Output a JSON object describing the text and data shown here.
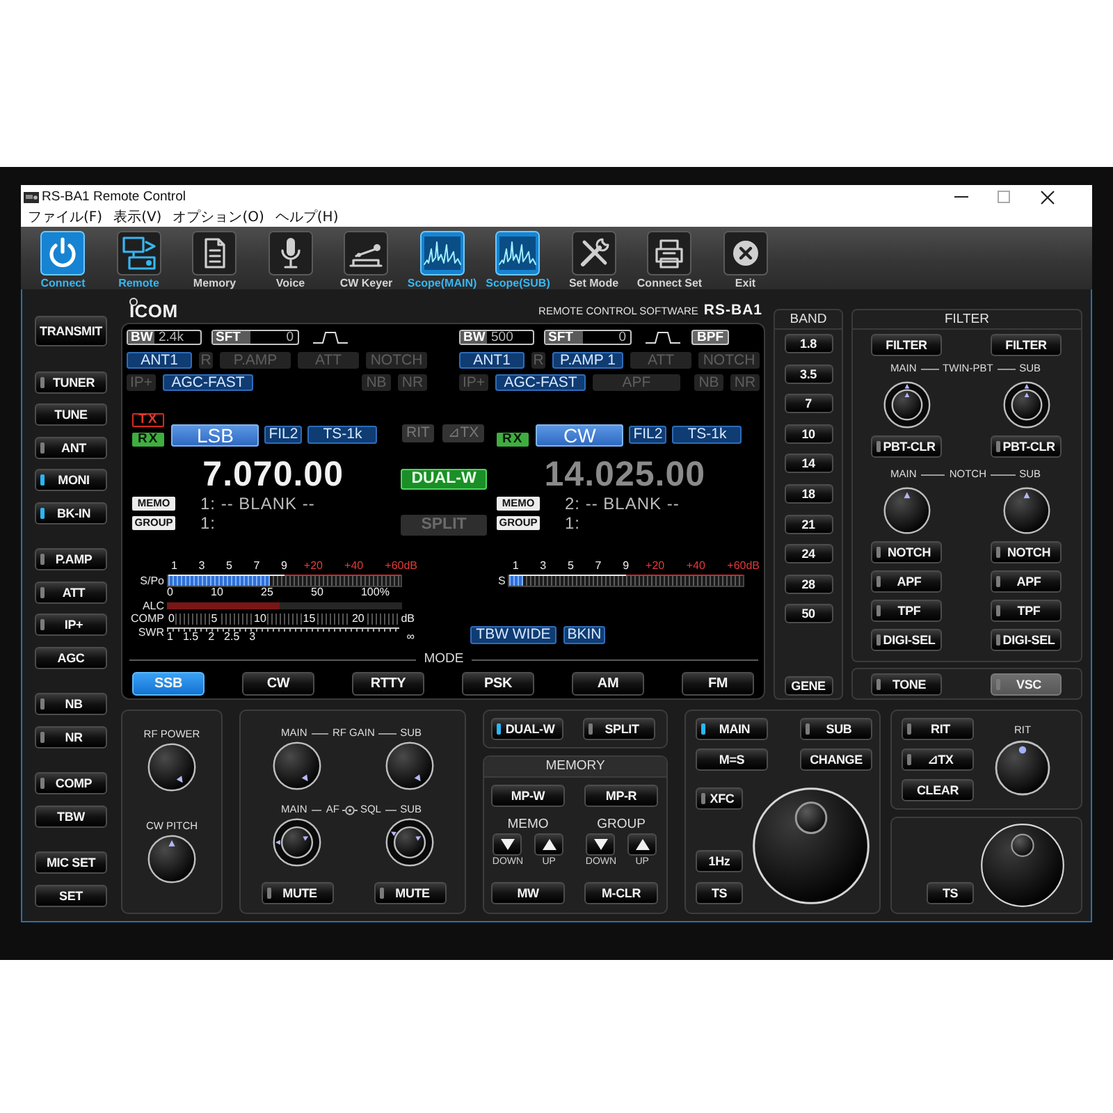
{
  "window": {
    "title": "RS-BA1 Remote Control"
  },
  "menu": [
    "ファイル(F)",
    "表示(V)",
    "オプション(O)",
    "ヘルプ(H)"
  ],
  "toolbar": [
    {
      "label": "Connect",
      "kind": "power",
      "selected": true
    },
    {
      "label": "Remote",
      "kind": "remote",
      "selected": true
    },
    {
      "label": "Memory",
      "kind": "memory",
      "selected": false
    },
    {
      "label": "Voice",
      "kind": "mic",
      "selected": false
    },
    {
      "label": "CW Keyer",
      "kind": "key",
      "selected": false
    },
    {
      "label": "Scope(MAIN)",
      "kind": "scope",
      "selected": true
    },
    {
      "label": "Scope(SUB)",
      "kind": "scope",
      "selected": true
    },
    {
      "label": "Set Mode",
      "kind": "tools",
      "selected": false
    },
    {
      "label": "Connect Set",
      "kind": "printer",
      "selected": false
    },
    {
      "label": "Exit",
      "kind": "exit",
      "selected": false
    }
  ],
  "left_panel": [
    {
      "buttons": [
        {
          "label": "TRANSMIT",
          "kind": "large"
        }
      ]
    },
    {
      "buttons": [
        {
          "label": "TUNER",
          "kind": "led",
          "on": false
        },
        {
          "label": "TUNE",
          "kind": "plain"
        },
        {
          "label": "ANT",
          "kind": "led",
          "on": false
        },
        {
          "label": "MONI",
          "kind": "led",
          "on": true
        },
        {
          "label": "BK-IN",
          "kind": "led",
          "on": true
        }
      ]
    },
    {
      "buttons": [
        {
          "label": "P.AMP",
          "kind": "led",
          "on": false
        },
        {
          "label": "ATT",
          "kind": "led",
          "on": false
        },
        {
          "label": "IP+",
          "kind": "led",
          "on": false
        },
        {
          "label": "AGC",
          "kind": "plain"
        }
      ]
    },
    {
      "buttons": [
        {
          "label": "NB",
          "kind": "led",
          "on": false
        },
        {
          "label": "NR",
          "kind": "led",
          "on": false
        }
      ]
    },
    {
      "buttons": [
        {
          "label": "COMP",
          "kind": "led",
          "on": false
        },
        {
          "label": "TBW",
          "kind": "plain"
        }
      ]
    },
    {
      "buttons": [
        {
          "label": "MIC SET",
          "kind": "plain"
        },
        {
          "label": "SET",
          "kind": "plain"
        }
      ]
    }
  ],
  "display": {
    "brand": "ICOM",
    "software": "REMOTE CONTROL SOFTWARE",
    "model": "RS-BA1",
    "receivers": [
      {
        "selected": true,
        "bw": {
          "label": "BW",
          "value": "2.4k"
        },
        "sft": {
          "label": "SFT",
          "value": "0"
        },
        "row2": [
          {
            "label": "ANT1",
            "on": true
          },
          {
            "label": "R",
            "on": false
          },
          {
            "label": "P.AMP",
            "on": false
          },
          {
            "label": "ATT",
            "on": false
          },
          {
            "label": "NOTCH",
            "on": false
          }
        ],
        "row3_left": [
          {
            "label": "IP+",
            "on": false
          },
          {
            "label": "AGC-FAST",
            "on": true
          }
        ],
        "row3_right": [
          {
            "label": "NB",
            "on": false
          },
          {
            "label": "NR",
            "on": false
          }
        ],
        "indicators": [
          {
            "label": "TX",
            "kind": "tx",
            "on": false
          },
          {
            "label": "RX",
            "kind": "rx",
            "on": true
          }
        ],
        "mode": "LSB",
        "mode_tags": [
          {
            "label": "FIL2",
            "on": true
          },
          {
            "label": "TS-1k",
            "on": true
          }
        ],
        "frequency": "7.070.00",
        "memo": {
          "label": "MEMO",
          "value": "1: -- BLANK --"
        },
        "group": {
          "label": "GROUP",
          "value": "1:"
        },
        "meter": {
          "label": "S/Po",
          "s_units": [
            "1",
            "3",
            "5",
            "7",
            "9"
          ],
          "over": [
            "+20",
            "+40",
            "+60dB"
          ],
          "level": 0.44,
          "po_scale": [
            "0",
            "10",
            "25",
            "50",
            "100%"
          ],
          "alc": "ALC",
          "comp": {
            "label": "COMP",
            "scale": [
              "0",
              "5",
              "10",
              "15",
              "20",
              "dB"
            ]
          },
          "swr": {
            "label": "SWR",
            "scale": [
              "1",
              "1.5",
              "2",
              "2.5",
              "3",
              "∞"
            ]
          }
        }
      },
      {
        "selected": false,
        "bw": {
          "label": "BW",
          "value": "500"
        },
        "sft": {
          "label": "SFT",
          "value": "0"
        },
        "flags": [
          {
            "label": "BPF",
            "on": true
          }
        ],
        "row2": [
          {
            "label": "ANT1",
            "on": true
          },
          {
            "label": "R",
            "on": false
          },
          {
            "label": "P.AMP 1",
            "on": true
          },
          {
            "label": "ATT",
            "on": false
          },
          {
            "label": "NOTCH",
            "on": false
          }
        ],
        "row3_left": [
          {
            "label": "IP+",
            "on": false
          },
          {
            "label": "AGC-FAST",
            "on": true
          },
          {
            "label": "APF",
            "on": false
          }
        ],
        "row3_right": [
          {
            "label": "NB",
            "on": false
          },
          {
            "label": "NR",
            "on": false
          }
        ],
        "indicators": [
          {
            "label": "RX",
            "kind": "rx",
            "on": true
          }
        ],
        "mode": "CW",
        "mode_tags": [
          {
            "label": "FIL2",
            "on": true
          },
          {
            "label": "TS-1k",
            "on": true
          }
        ],
        "frequency": "14.025.00",
        "memo": {
          "label": "MEMO",
          "value": "2: -- BLANK --"
        },
        "group": {
          "label": "GROUP",
          "value": "1:"
        },
        "meter": {
          "label": "S",
          "s_units": [
            "1",
            "3",
            "5",
            "7",
            "9"
          ],
          "over": [
            "+20",
            "+40",
            "+60dB"
          ],
          "level": 0.06
        }
      }
    ],
    "center": {
      "tags": [
        {
          "label": "RIT",
          "on": false
        },
        {
          "label": "⊿TX",
          "on": false
        }
      ],
      "switches": [
        {
          "label": "DUAL-W",
          "on": true
        },
        {
          "label": "SPLIT",
          "on": false
        }
      ]
    },
    "status_tags": [
      {
        "label": "TBW WIDE",
        "on": true
      },
      {
        "label": "BKIN",
        "on": true
      }
    ],
    "mode_title": "MODE",
    "modes": [
      {
        "label": "SSB",
        "selected": true
      },
      {
        "label": "CW",
        "selected": false
      },
      {
        "label": "RTTY",
        "selected": false
      },
      {
        "label": "PSK",
        "selected": false
      },
      {
        "label": "AM",
        "selected": false
      },
      {
        "label": "FM",
        "selected": false
      }
    ]
  },
  "band": {
    "title": "BAND",
    "buttons": [
      "1.8",
      "3.5",
      "7",
      "10",
      "14",
      "18",
      "21",
      "24",
      "28",
      "50"
    ],
    "extra_button": "GENE"
  },
  "filter": {
    "title": "FILTER",
    "buttons": [
      "FILTER",
      "FILTER"
    ],
    "pbt_caption": {
      "left": "MAIN",
      "center": "TWIN-PBT",
      "right": "SUB"
    },
    "pbt_knobs": [
      {
        "outer": {
          "kind": "up"
        },
        "inner": {
          "kind": "up"
        }
      },
      {
        "outer": {
          "kind": "up"
        },
        "inner": {
          "kind": "up"
        }
      }
    ],
    "pbt_clear": [
      {
        "label": "PBT-CLR",
        "on": false
      },
      {
        "label": "PBT-CLR",
        "on": false
      }
    ],
    "notch_caption": {
      "left": "MAIN",
      "center": "NOTCH",
      "right": "SUB"
    },
    "notch_knobs": [
      {
        "kind": "up"
      },
      {
        "kind": "up"
      }
    ],
    "switches": [
      {
        "label": "NOTCH",
        "on": false
      },
      {
        "label": "NOTCH",
        "on": false
      },
      {
        "label": "APF",
        "on": false
      },
      {
        "label": "APF",
        "on": false
      },
      {
        "label": "TPF",
        "on": false
      },
      {
        "label": "TPF",
        "on": false
      },
      {
        "label": "DIGI-SEL",
        "on": false
      },
      {
        "label": "DIGI-SEL",
        "on": false
      }
    ]
  },
  "tone_panel": [
    {
      "label": "TONE",
      "on": false,
      "disabled": false
    },
    {
      "label": "VSC",
      "on": false,
      "disabled": true
    }
  ],
  "rf_panel": {
    "knobs": [
      {
        "label": "RF POWER",
        "kind": "lower-right"
      },
      {
        "label": "CW PITCH",
        "kind": "up"
      }
    ]
  },
  "gain_panel": {
    "rf_caption": {
      "left": "MAIN",
      "center": "RF GAIN",
      "right": "SUB"
    },
    "rf_knobs": [
      {
        "kind": "lower-right"
      },
      {
        "kind": "lower-right"
      }
    ],
    "af_caption": {
      "left": "MAIN",
      "center": "AF",
      "center_right": "SQL",
      "right": "SUB"
    },
    "af_knobs": [
      {
        "outer": {
          "kind": "left"
        },
        "inner": {
          "kind": "upper-right"
        }
      },
      {
        "outer": {
          "kind": "upper-left"
        },
        "inner": {
          "kind": "upper-right"
        }
      }
    ],
    "mute": [
      {
        "label": "MUTE",
        "on": false
      },
      {
        "label": "MUTE",
        "on": false
      }
    ]
  },
  "dual_split": [
    {
      "label": "DUAL-W",
      "on": true
    },
    {
      "label": "SPLIT",
      "on": false
    }
  ],
  "memory": {
    "title": "MEMORY",
    "top": [
      "MP-W",
      "MP-R"
    ],
    "steppers": [
      {
        "label": "MEMO",
        "down": "DOWN",
        "up": "UP"
      },
      {
        "label": "GROUP",
        "down": "DOWN",
        "up": "UP"
      }
    ],
    "bottom": [
      "MW",
      "M-CLR"
    ]
  },
  "main_dial": {
    "buttons": [
      {
        "label": "MAIN",
        "kind": "led",
        "on": true
      },
      {
        "label": "SUB",
        "kind": "led",
        "on": false
      },
      {
        "label": "M=S",
        "kind": "plain"
      },
      {
        "label": "CHANGE",
        "kind": "plain"
      }
    ],
    "xfc": {
      "label": "XFC",
      "on": false
    },
    "step_buttons": [
      "1Hz",
      "TS"
    ]
  },
  "rit": {
    "buttons": [
      {
        "label": "RIT",
        "kind": "led",
        "on": false
      },
      {
        "label": "⊿TX",
        "kind": "led",
        "on": false
      },
      {
        "label": "CLEAR",
        "kind": "plain"
      }
    ],
    "knob": {
      "label": "RIT",
      "kind": "up"
    }
  },
  "sub_dial": {
    "button": "TS"
  }
}
